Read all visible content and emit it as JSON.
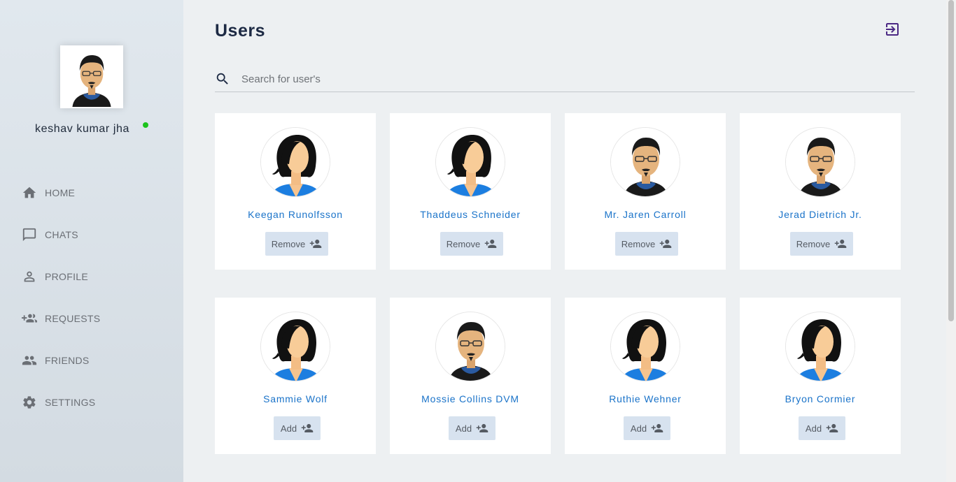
{
  "sidebar": {
    "user_name": "keshav kumar jha",
    "status": "online",
    "status_color": "#1cc31c",
    "items": [
      {
        "label": "HOME",
        "icon": "home-icon"
      },
      {
        "label": "CHATS",
        "icon": "chat-icon"
      },
      {
        "label": "PROFILE",
        "icon": "person-icon"
      },
      {
        "label": "REQUESTS",
        "icon": "group-add-icon"
      },
      {
        "label": "FRIENDS",
        "icon": "people-icon"
      },
      {
        "label": "SETTINGS",
        "icon": "gear-icon"
      }
    ]
  },
  "header": {
    "title": "Users",
    "logout_icon": "logout-icon"
  },
  "search": {
    "placeholder": "Search for user's",
    "value": ""
  },
  "users": [
    {
      "name": "Keegan Runolfsson",
      "avatar": "female-avatar",
      "action": "Remove"
    },
    {
      "name": "Thaddeus Schneider",
      "avatar": "female-avatar",
      "action": "Remove"
    },
    {
      "name": "Mr. Jaren Carroll",
      "avatar": "male-avatar",
      "action": "Remove"
    },
    {
      "name": "Jerad Dietrich Jr.",
      "avatar": "male-avatar",
      "action": "Remove"
    },
    {
      "name": "Sammie Wolf",
      "avatar": "female-avatar",
      "action": "Add"
    },
    {
      "name": "Mossie Collins DVM",
      "avatar": "male-avatar",
      "action": "Add"
    },
    {
      "name": "Ruthie Wehner",
      "avatar": "female-avatar",
      "action": "Add"
    },
    {
      "name": "Bryon Cormier",
      "avatar": "female-avatar",
      "action": "Add"
    }
  ],
  "colors": {
    "accent_name": "#1a73c9",
    "button_bg": "#d7e2ef",
    "logout_icon": "#4b2884"
  }
}
